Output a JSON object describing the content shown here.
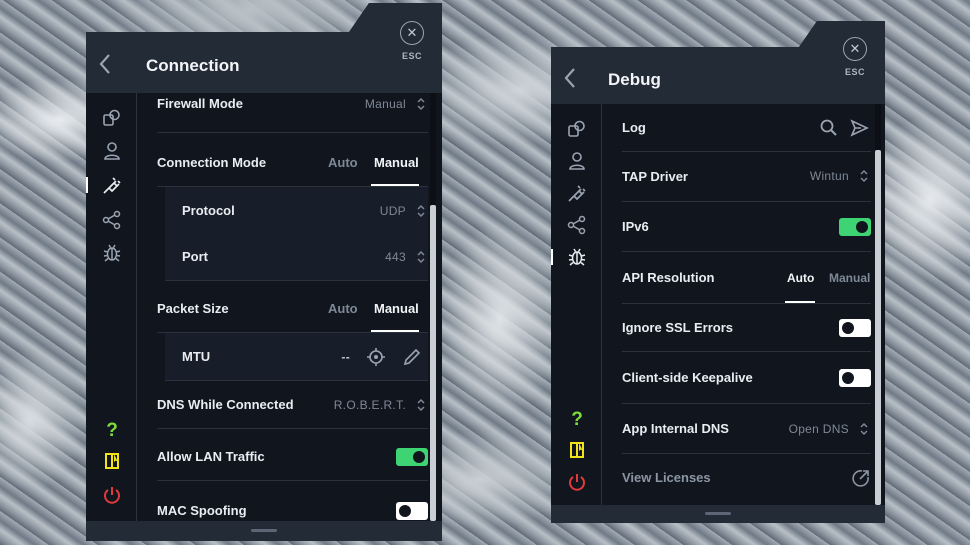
{
  "connection": {
    "title": "Connection",
    "esc_label": "ESC",
    "rows": {
      "firewall_mode": {
        "label": "Firewall Mode",
        "value": "Manual"
      },
      "connection_mode": {
        "label": "Connection Mode",
        "auto": "Auto",
        "manual": "Manual",
        "selected": "Manual"
      },
      "protocol": {
        "label": "Protocol",
        "value": "UDP"
      },
      "port": {
        "label": "Port",
        "value": "443"
      },
      "packet_size": {
        "label": "Packet Size",
        "auto": "Auto",
        "manual": "Manual",
        "selected": "Manual"
      },
      "mtu": {
        "label": "MTU",
        "value": "--"
      },
      "dns_while_connected": {
        "label": "DNS While Connected",
        "value": "R.O.B.E.R.T."
      },
      "allow_lan_traffic": {
        "label": "Allow LAN Traffic",
        "enabled": true
      },
      "mac_spoofing": {
        "label": "MAC Spoofing",
        "enabled": false
      }
    }
  },
  "debug": {
    "title": "Debug",
    "esc_label": "ESC",
    "rows": {
      "log": {
        "label": "Log"
      },
      "tap_driver": {
        "label": "TAP Driver",
        "value": "Wintun"
      },
      "ipv6": {
        "label": "IPv6",
        "enabled": true
      },
      "api_resolution": {
        "label": "API Resolution",
        "auto": "Auto",
        "manual": "Manual",
        "selected": "Auto"
      },
      "ignore_ssl_errors": {
        "label": "Ignore SSL Errors",
        "enabled": false
      },
      "client_side_keepalive": {
        "label": "Client-side Keepalive",
        "enabled": false
      },
      "app_internal_dns": {
        "label": "App Internal DNS",
        "value": "Open DNS"
      },
      "view_licenses": {
        "label": "View Licenses"
      }
    }
  },
  "colors": {
    "panel_bg": "#11161e",
    "header_bg": "#232b37",
    "toggle_on": "#3ed473",
    "help_icon": "#7ddc3c",
    "docs_icon": "#f2e21a",
    "power_icon": "#e03a3a"
  }
}
